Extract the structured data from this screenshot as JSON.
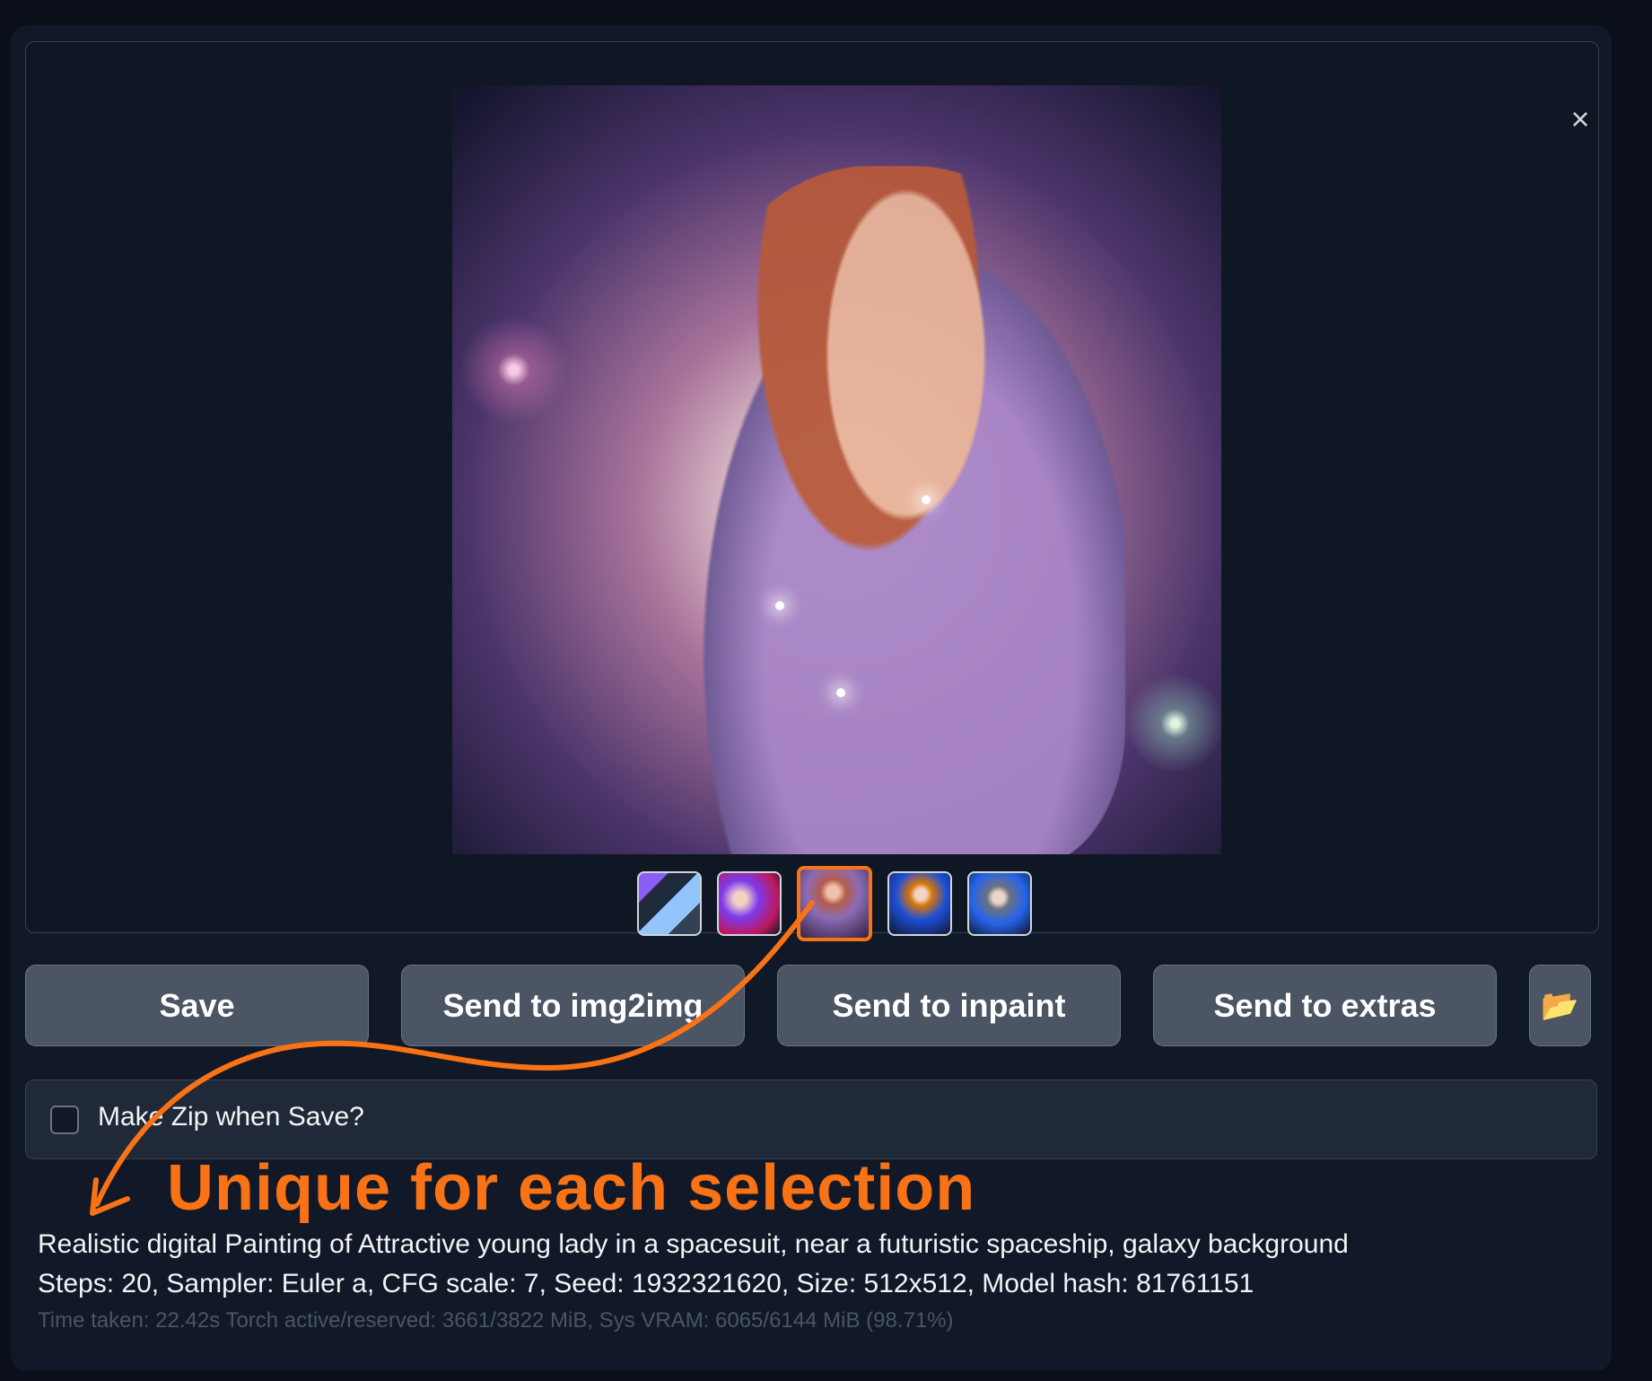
{
  "gallery": {
    "close_icon": "×",
    "thumbnails": [
      {
        "name": "thumbnail-1"
      },
      {
        "name": "thumbnail-2"
      },
      {
        "name": "thumbnail-3",
        "selected": true
      },
      {
        "name": "thumbnail-4"
      },
      {
        "name": "thumbnail-5"
      }
    ]
  },
  "actions": {
    "save": "Save",
    "send_img2img": "Send to img2img",
    "send_inpaint": "Send to inpaint",
    "send_extras": "Send to extras",
    "folder_icon": "📂"
  },
  "options": {
    "zip_label": "Make Zip when Save?"
  },
  "annotation": {
    "text": "Unique for each selection",
    "color": "#f97316"
  },
  "generation_info": {
    "prompt": "Realistic digital Painting of Attractive young lady in a spacesuit, near a futuristic spaceship, galaxy background",
    "params": "Steps: 20, Sampler: Euler a, CFG scale: 7, Seed: 1932321620, Size: 512x512, Model hash: 81761151",
    "stats": "Time taken: 22.42s  Torch active/reserved: 3661/3822 MiB, Sys VRAM: 6065/6144 MiB (98.71%)"
  },
  "colors": {
    "background": "#0b0f19",
    "panel": "#111827",
    "button": "#4b5563",
    "accent": "#f97316"
  }
}
